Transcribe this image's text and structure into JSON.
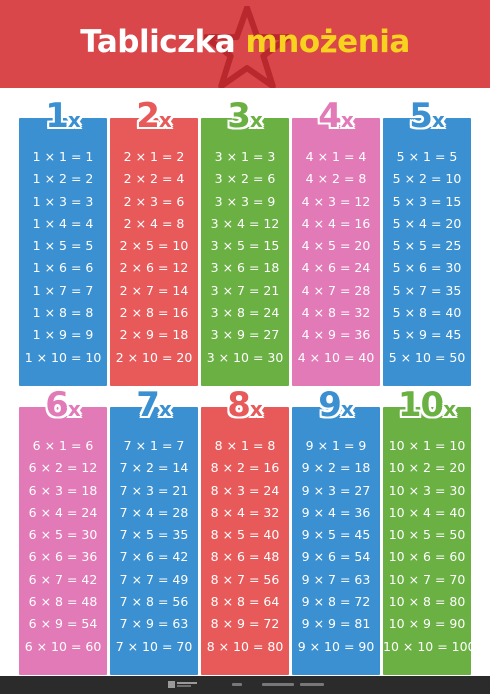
{
  "title": {
    "part1": "Tabliczka",
    "part2": "mnożenia"
  },
  "colors": {
    "blue": "#3a90d0",
    "red": "#e8595a",
    "green": "#6ab043",
    "pink": "#e27ab7",
    "header": "#d9474a",
    "title_accent": "#f7d31f"
  },
  "tables": [
    {
      "label": "1",
      "suffix": "x",
      "color": "blue",
      "rows": [
        "1 × 1 = 1",
        "1 × 2 = 2",
        "1 × 3 = 3",
        "1 × 4 = 4",
        "1 × 5 = 5",
        "1 × 6 = 6",
        "1 × 7 = 7",
        "1 × 8 = 8",
        "1 × 9 = 9",
        "1 × 10 = 10"
      ]
    },
    {
      "label": "2",
      "suffix": "x",
      "color": "red",
      "rows": [
        "2 × 1 = 2",
        "2 × 2 = 4",
        "2 × 3 = 6",
        "2 × 4 = 8",
        "2 × 5 = 10",
        "2 × 6 = 12",
        "2 × 7 = 14",
        "2 × 8 = 16",
        "2 × 9 = 18",
        "2 × 10 = 20"
      ]
    },
    {
      "label": "3",
      "suffix": "x",
      "color": "green",
      "rows": [
        "3 × 1 = 3",
        "3 × 2 = 6",
        "3 × 3 = 9",
        "3 × 4 = 12",
        "3 × 5 = 15",
        "3 × 6 = 18",
        "3 × 7 = 21",
        "3 × 8 = 24",
        "3 × 9 = 27",
        "3 × 10 = 30"
      ]
    },
    {
      "label": "4",
      "suffix": "x",
      "color": "pink",
      "rows": [
        "4 × 1 = 4",
        "4 × 2 = 8",
        "4 × 3 = 12",
        "4 × 4 = 16",
        "4 × 5 = 20",
        "4 × 6 = 24",
        "4 × 7 = 28",
        "4 × 8 = 32",
        "4 × 9 = 36",
        "4 × 10 = 40"
      ]
    },
    {
      "label": "5",
      "suffix": "x",
      "color": "blue",
      "rows": [
        "5 × 1 = 5",
        "5 × 2 = 10",
        "5 × 3 = 15",
        "5 × 4 = 20",
        "5 × 5 = 25",
        "5 × 6 = 30",
        "5 × 7 = 35",
        "5 × 8 = 40",
        "5 × 9 = 45",
        "5 × 10 = 50"
      ]
    },
    {
      "label": "6",
      "suffix": "x",
      "color": "pink",
      "rows": [
        "6 × 1 = 6",
        "6 × 2 = 12",
        "6 × 3 = 18",
        "6 × 4 = 24",
        "6 × 5 = 30",
        "6 × 6 = 36",
        "6 × 7 = 42",
        "6 × 8 = 48",
        "6 × 9 = 54",
        "6 × 10 = 60"
      ]
    },
    {
      "label": "7",
      "suffix": "x",
      "color": "blue",
      "rows": [
        "7 × 1 = 7",
        "7 × 2 = 14",
        "7 × 3 = 21",
        "7 × 4 = 28",
        "7 × 5 = 35",
        "7 × 6 = 42",
        "7 × 7 = 49",
        "7 × 8 = 56",
        "7 × 9 = 63",
        "7 × 10 = 70"
      ]
    },
    {
      "label": "8",
      "suffix": "x",
      "color": "red",
      "rows": [
        "8 × 1 = 8",
        "8 × 2 = 16",
        "8 × 3 = 24",
        "8 × 4 = 32",
        "8 × 5 = 40",
        "8 × 6 = 48",
        "8 × 7 = 56",
        "8 × 8 = 64",
        "8 × 9 = 72",
        "8 × 10 = 80"
      ]
    },
    {
      "label": "9",
      "suffix": "x",
      "color": "blue",
      "rows": [
        "9 × 1 = 9",
        "9 × 2 = 18",
        "9 × 3 = 27",
        "9 × 4 = 36",
        "9 × 5 = 45",
        "9 × 6 = 54",
        "9 × 7 = 63",
        "9 × 8 = 72",
        "9 × 9 = 81",
        "9 × 10 = 90"
      ]
    },
    {
      "label": "10",
      "suffix": "x",
      "color": "green",
      "rows": [
        "10 × 1 = 10",
        "10 × 2 = 20",
        "10 × 3 = 30",
        "10 × 4 = 40",
        "10 × 5 = 50",
        "10 × 6 = 60",
        "10 × 7 = 70",
        "10 × 8 = 80",
        "10 × 9 = 90",
        "10 × 10 = 100"
      ]
    }
  ],
  "footer": {
    "logo_icon": "publisher-logo-icon"
  }
}
